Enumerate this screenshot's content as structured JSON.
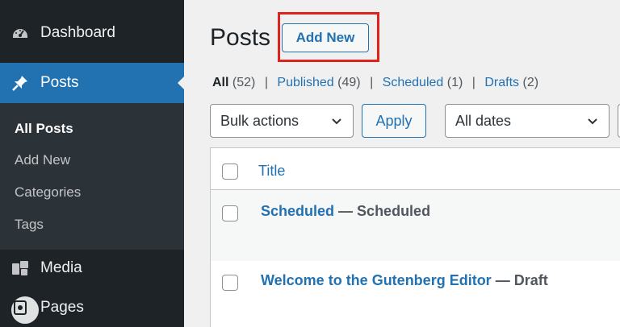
{
  "sidebar": {
    "dashboard": {
      "label": "Dashboard",
      "icon": "dashboard-icon"
    },
    "posts": {
      "label": "Posts",
      "icon": "pushpin-icon"
    },
    "submenu": [
      {
        "label": "All Posts",
        "current": true
      },
      {
        "label": "Add New"
      },
      {
        "label": "Categories"
      },
      {
        "label": "Tags"
      }
    ],
    "media": {
      "label": "Media",
      "icon": "media-icon"
    },
    "pages": {
      "label": "Pages",
      "icon": "pages-icon"
    }
  },
  "main": {
    "title": "Posts",
    "add_new_label": "Add New",
    "filters": {
      "all": {
        "label": "All",
        "count": "(52)"
      },
      "published": {
        "label": "Published",
        "count": "(49)"
      },
      "scheduled": {
        "label": "Scheduled",
        "count": "(1)"
      },
      "drafts": {
        "label": "Drafts",
        "count": "(2)"
      },
      "separator": "|"
    },
    "bulk_actions": {
      "value": "Bulk actions"
    },
    "apply_label": "Apply",
    "dates": {
      "value": "All dates"
    },
    "table": {
      "title_column": "Title",
      "rows": [
        {
          "title": "Scheduled",
          "state": "— Scheduled"
        },
        {
          "title": "Welcome to the Gutenberg Editor",
          "state": "— Draft"
        }
      ]
    }
  },
  "colors": {
    "accent": "#2271b1",
    "sidebar_bg": "#1d2327",
    "highlight": "#e0221d"
  }
}
